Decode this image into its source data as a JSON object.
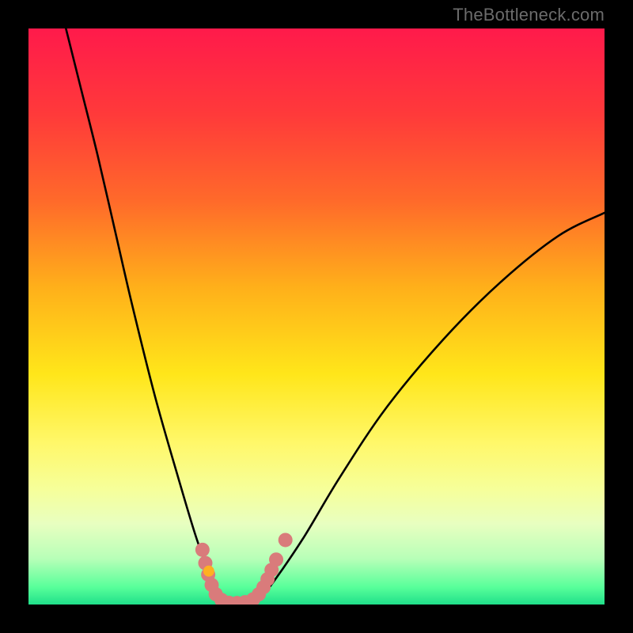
{
  "watermark": "TheBottleneck.com",
  "chart_data": {
    "type": "line",
    "title": "",
    "xlabel": "",
    "ylabel": "",
    "xlim": [
      0,
      100
    ],
    "ylim": [
      0,
      100
    ],
    "grid": false,
    "legend": false,
    "background_gradient": {
      "stops": [
        {
          "offset": 0.0,
          "color": "#ff1a4b"
        },
        {
          "offset": 0.15,
          "color": "#ff3a3a"
        },
        {
          "offset": 0.3,
          "color": "#ff6a2a"
        },
        {
          "offset": 0.45,
          "color": "#ffb01a"
        },
        {
          "offset": 0.6,
          "color": "#ffe61a"
        },
        {
          "offset": 0.72,
          "color": "#fff86a"
        },
        {
          "offset": 0.8,
          "color": "#f6ff9a"
        },
        {
          "offset": 0.86,
          "color": "#e8ffc0"
        },
        {
          "offset": 0.92,
          "color": "#b8ffb8"
        },
        {
          "offset": 0.97,
          "color": "#58ff9a"
        },
        {
          "offset": 1.0,
          "color": "#20e08a"
        }
      ]
    },
    "series": [
      {
        "name": "curve",
        "color": "#000000",
        "points": [
          {
            "x": 6.5,
            "y": 100
          },
          {
            "x": 9,
            "y": 90
          },
          {
            "x": 12,
            "y": 78
          },
          {
            "x": 15,
            "y": 65
          },
          {
            "x": 18,
            "y": 52
          },
          {
            "x": 22,
            "y": 36
          },
          {
            "x": 26,
            "y": 22
          },
          {
            "x": 29,
            "y": 12
          },
          {
            "x": 31.5,
            "y": 5
          },
          {
            "x": 33,
            "y": 1.5
          },
          {
            "x": 34.5,
            "y": 0.3
          },
          {
            "x": 37,
            "y": 0.2
          },
          {
            "x": 39,
            "y": 0.6
          },
          {
            "x": 41,
            "y": 2
          },
          {
            "x": 44,
            "y": 6
          },
          {
            "x": 48,
            "y": 12
          },
          {
            "x": 54,
            "y": 22
          },
          {
            "x": 62,
            "y": 34
          },
          {
            "x": 72,
            "y": 46
          },
          {
            "x": 82,
            "y": 56
          },
          {
            "x": 92,
            "y": 64
          },
          {
            "x": 100,
            "y": 68
          }
        ]
      }
    ],
    "markers": {
      "name": "dip-markers",
      "color": "#d97b7b",
      "radius": 9,
      "points": [
        {
          "x": 30.2,
          "y": 9.5
        },
        {
          "x": 30.7,
          "y": 7.2
        },
        {
          "x": 31.2,
          "y": 5.2
        },
        {
          "x": 31.8,
          "y": 3.4
        },
        {
          "x": 32.5,
          "y": 1.8
        },
        {
          "x": 33.5,
          "y": 0.8
        },
        {
          "x": 34.8,
          "y": 0.3
        },
        {
          "x": 36.2,
          "y": 0.25
        },
        {
          "x": 37.6,
          "y": 0.4
        },
        {
          "x": 39.0,
          "y": 0.9
        },
        {
          "x": 40.0,
          "y": 1.8
        },
        {
          "x": 40.8,
          "y": 3.0
        },
        {
          "x": 41.5,
          "y": 4.4
        },
        {
          "x": 42.2,
          "y": 6.0
        },
        {
          "x": 43.0,
          "y": 7.8
        },
        {
          "x": 44.6,
          "y": 11.2
        }
      ]
    },
    "accent_marker": {
      "name": "accent-dot",
      "color": "#ffb020",
      "radius": 7,
      "point": {
        "x": 31.3,
        "y": 5.8
      }
    }
  }
}
